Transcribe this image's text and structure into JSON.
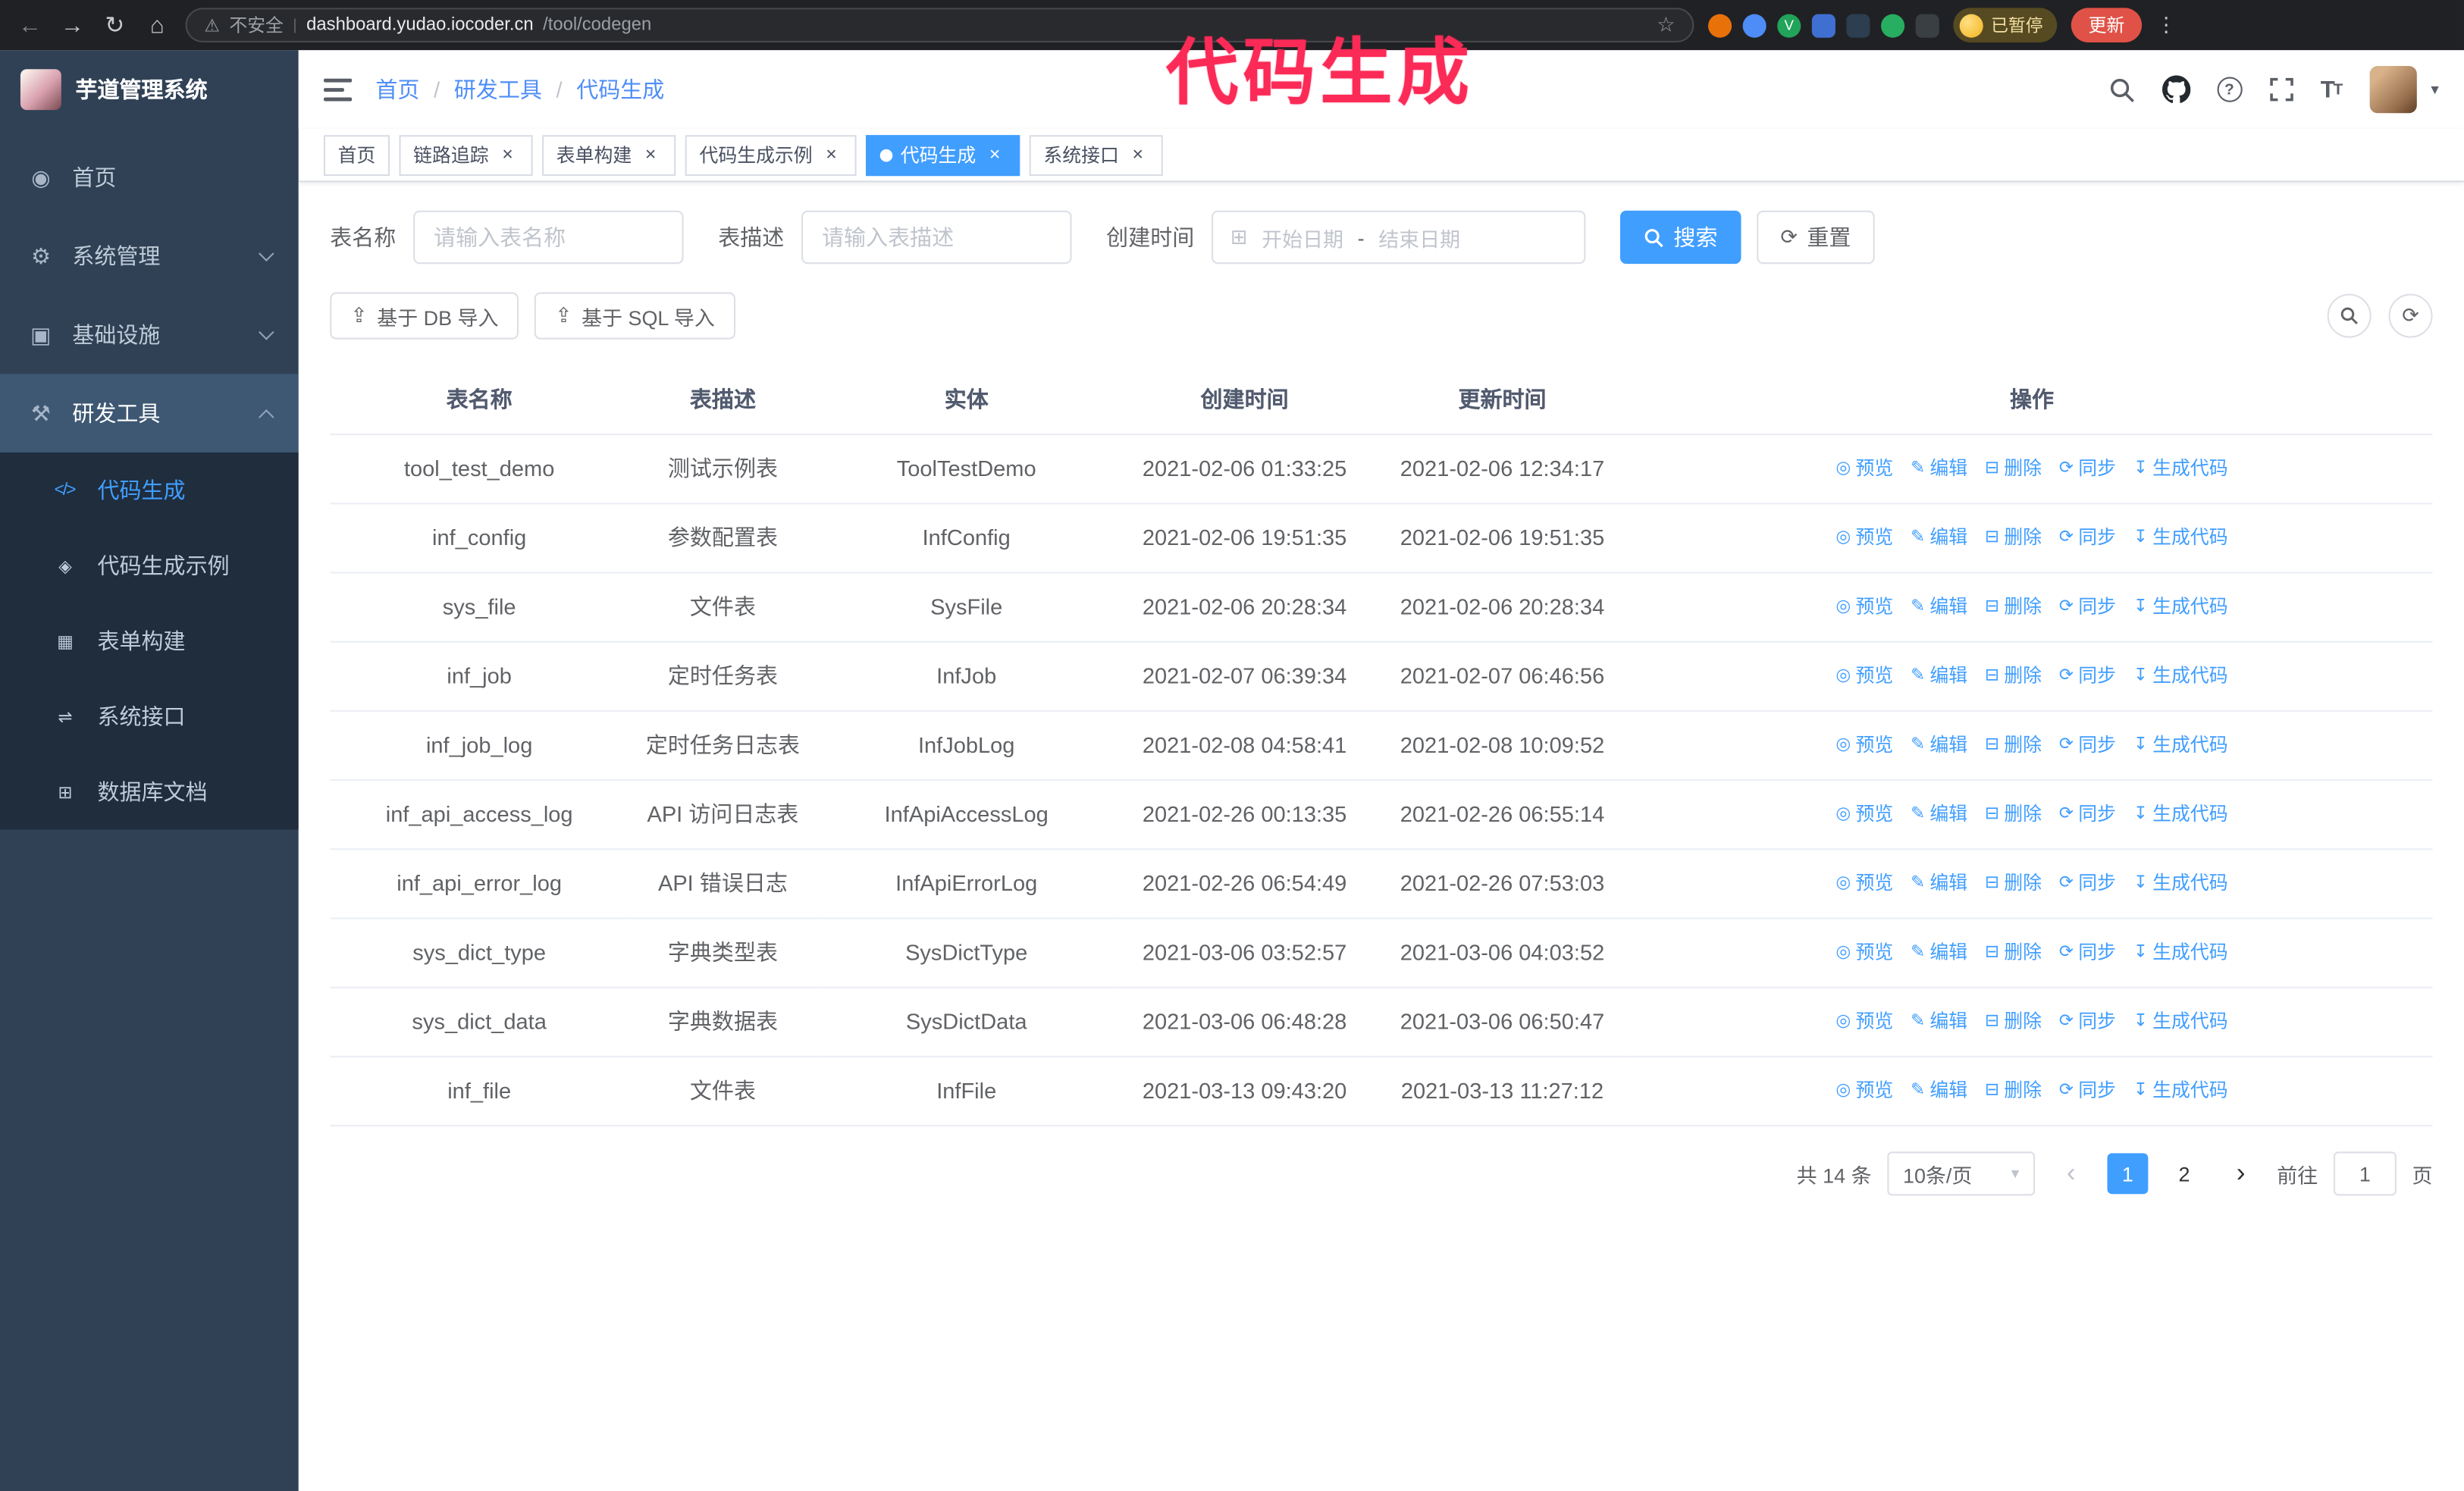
{
  "browser": {
    "security_label": "不安全",
    "url_host": "dashboard.yudao.iocoder.cn",
    "url_path": "/tool/codegen",
    "url_divider": "|",
    "paused_badge": "已暂停",
    "update_button": "更新"
  },
  "annotation": {
    "text": "代码生成",
    "color": "#fb2a57"
  },
  "icons": {
    "close-icon": "×",
    "back-icon": "←",
    "forward-icon": "→",
    "reload-icon": "↻",
    "home-icon": "⌂",
    "warning-icon": "⚠",
    "star-icon": "☆",
    "kebab-icon": "⋮",
    "dashboard-icon": "◉",
    "gear-icon": "⚙",
    "infrastructure-icon": "▣",
    "tools-icon": "⚒",
    "code-icon": "</>",
    "example-icon": "◈",
    "form-icon": "▦",
    "api-icon": "⇌",
    "dbdoc-icon": "⊞",
    "preview-icon": "◎",
    "edit-icon": "✎",
    "delete-icon": "⊟",
    "sync-icon": "⟳",
    "generate-icon": "↧",
    "upload-icon": "⇪",
    "calendar-icon": "⊞",
    "refresh-icon": "⟳",
    "caret-down-icon": "▾",
    "chevron-left-icon": "‹",
    "chevron-right-icon": "›",
    "help-icon": "?",
    "font-size-icon": "T",
    "ext-v-icon": "V"
  },
  "sidebar": {
    "logo_title": "芋道管理系统",
    "items": [
      {
        "label": "首页"
      },
      {
        "label": "系统管理"
      },
      {
        "label": "基础设施"
      },
      {
        "label": "研发工具"
      }
    ],
    "submenu": [
      {
        "label": "代码生成"
      },
      {
        "label": "代码生成示例"
      },
      {
        "label": "表单构建"
      },
      {
        "label": "系统接口"
      },
      {
        "label": "数据库文档"
      }
    ]
  },
  "navbar": {
    "breadcrumb": [
      "首页",
      "研发工具",
      "代码生成"
    ],
    "separator": "/"
  },
  "tabs": [
    {
      "label": "首页"
    },
    {
      "label": "链路追踪"
    },
    {
      "label": "表单构建"
    },
    {
      "label": "代码生成示例"
    },
    {
      "label": "代码生成"
    },
    {
      "label": "系统接口"
    }
  ],
  "filters": {
    "table_name_label": "表名称",
    "table_name_placeholder": "请输入表名称",
    "table_desc_label": "表描述",
    "table_desc_placeholder": "请输入表描述",
    "create_time_label": "创建时间",
    "date_start_placeholder": "开始日期",
    "date_separator": "-",
    "date_end_placeholder": "结束日期",
    "search_button": "搜索",
    "reset_button": "重置"
  },
  "toolbar": {
    "import_db_button": "基于 DB 导入",
    "import_sql_button": "基于 SQL 导入"
  },
  "table": {
    "columns": [
      "表名称",
      "表描述",
      "实体",
      "创建时间",
      "更新时间",
      "操作"
    ],
    "action_labels": [
      "预览",
      "编辑",
      "删除",
      "同步",
      "生成代码"
    ],
    "rows": [
      {
        "name": "tool_test_demo",
        "desc": "测试示例表",
        "entity": "ToolTestDemo",
        "created": "2021-02-06 01:33:25",
        "updated": "2021-02-06 12:34:17"
      },
      {
        "name": "inf_config",
        "desc": "参数配置表",
        "entity": "InfConfig",
        "created": "2021-02-06 19:51:35",
        "updated": "2021-02-06 19:51:35"
      },
      {
        "name": "sys_file",
        "desc": "文件表",
        "entity": "SysFile",
        "created": "2021-02-06 20:28:34",
        "updated": "2021-02-06 20:28:34"
      },
      {
        "name": "inf_job",
        "desc": "定时任务表",
        "entity": "InfJob",
        "created": "2021-02-07 06:39:34",
        "updated": "2021-02-07 06:46:56"
      },
      {
        "name": "inf_job_log",
        "desc": "定时任务日志表",
        "entity": "InfJobLog",
        "created": "2021-02-08 04:58:41",
        "updated": "2021-02-08 10:09:52"
      },
      {
        "name": "inf_api_access_log",
        "desc": "API 访问日志表",
        "entity": "InfApiAccessLog",
        "created": "2021-02-26 00:13:35",
        "updated": "2021-02-26 06:55:14"
      },
      {
        "name": "inf_api_error_log",
        "desc": "API 错误日志",
        "entity": "InfApiErrorLog",
        "created": "2021-02-26 06:54:49",
        "updated": "2021-02-26 07:53:03"
      },
      {
        "name": "sys_dict_type",
        "desc": "字典类型表",
        "entity": "SysDictType",
        "created": "2021-03-06 03:52:57",
        "updated": "2021-03-06 04:03:52"
      },
      {
        "name": "sys_dict_data",
        "desc": "字典数据表",
        "entity": "SysDictData",
        "created": "2021-03-06 06:48:28",
        "updated": "2021-03-06 06:50:47"
      },
      {
        "name": "inf_file",
        "desc": "文件表",
        "entity": "InfFile",
        "created": "2021-03-13 09:43:20",
        "updated": "2021-03-13 11:27:12"
      }
    ]
  },
  "pagination": {
    "total_text": "共 14 条",
    "page_size_text": "10条/页",
    "pages": [
      "1",
      "2"
    ],
    "active_page": "1",
    "goto_label": "前往",
    "goto_value": "1",
    "goto_suffix": "页"
  },
  "theme": {
    "primary": "#409eff",
    "sidebar_bg": "#304156",
    "submenu_bg": "#1f2d3d"
  }
}
